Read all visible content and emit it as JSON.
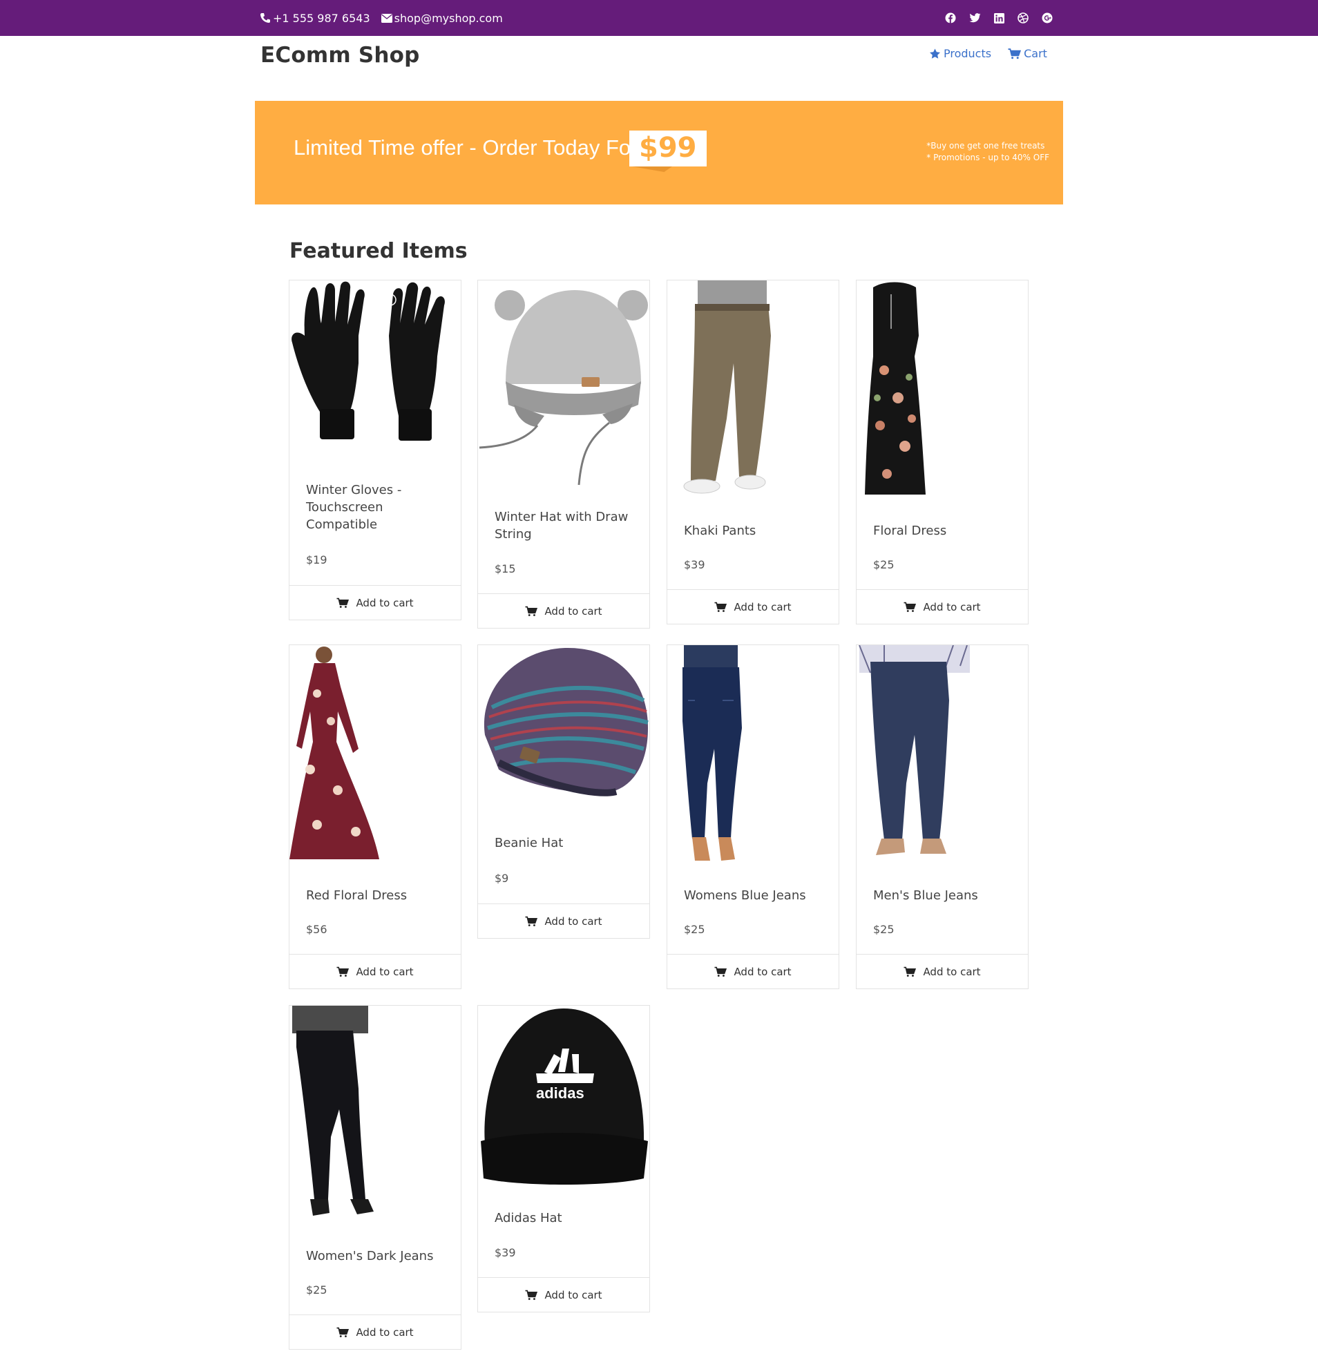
{
  "topbar": {
    "phone": "+1 555 987 6543",
    "email": "shop@myshop.com",
    "social_icons": [
      "facebook-icon",
      "twitter-icon",
      "linkedin-icon",
      "dribbble-icon",
      "google-plus-icon"
    ],
    "color": "#651c7a"
  },
  "header": {
    "brand": "EComm Shop",
    "nav": {
      "products_label": "Products",
      "cart_label": "Cart"
    },
    "link_color": "#3b71ca"
  },
  "banner": {
    "offer_text": "Limited Time offer - Order Today For",
    "price": "$99",
    "note_1": "*Buy one get one free treats",
    "note_2": "* Promotions - up to 40% OFF",
    "color": "#ffad42"
  },
  "main": {
    "title": "Featured Items",
    "add_to_cart_label": "Add to cart",
    "products": [
      {
        "name": "Winter Gloves - Touchscreen Compatible",
        "price": "$19"
      },
      {
        "name": "Winter Hat with Draw String",
        "price": "$15"
      },
      {
        "name": "Khaki Pants",
        "price": "$39"
      },
      {
        "name": "Floral Dress",
        "price": "$25"
      },
      {
        "name": "Red Floral Dress",
        "price": "$56"
      },
      {
        "name": "Beanie Hat",
        "price": "$9"
      },
      {
        "name": "Womens Blue Jeans",
        "price": "$25"
      },
      {
        "name": "Men's Blue Jeans",
        "price": "$25"
      },
      {
        "name": "Women's Dark Jeans",
        "price": "$25"
      },
      {
        "name": "Adidas Hat",
        "price": "$39"
      }
    ]
  }
}
